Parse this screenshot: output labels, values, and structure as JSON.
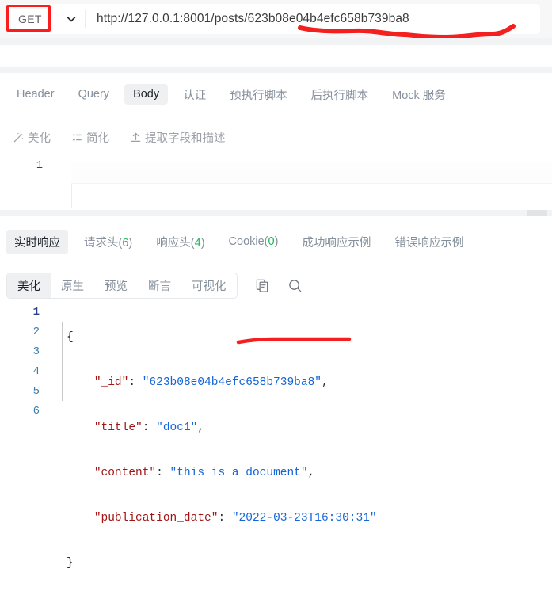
{
  "request": {
    "method": "GET",
    "url": "http://127.0.0.1:8001/posts/623b08e04b4efc658b739ba8",
    "method_dropdown_icon": "chevron-down-icon",
    "tabs": [
      {
        "label": "Header",
        "active": false
      },
      {
        "label": "Query",
        "active": false
      },
      {
        "label": "Body",
        "active": true
      },
      {
        "label": "认证",
        "active": false
      },
      {
        "label": "预执行脚本",
        "active": false
      },
      {
        "label": "后执行脚本",
        "active": false
      },
      {
        "label": "Mock 服务",
        "active": false
      }
    ],
    "tools": [
      {
        "label": "美化",
        "icon": "magic-wand-icon"
      },
      {
        "label": "简化",
        "icon": "compress-lines-icon"
      },
      {
        "label": "提取字段和描述",
        "icon": "upload-arrow-icon"
      }
    ],
    "editor": {
      "line_numbers": [
        "1"
      ],
      "content": ""
    }
  },
  "response": {
    "tabs": [
      {
        "label": "实时响应",
        "count": "",
        "active": true
      },
      {
        "label": "请求头",
        "count": "6",
        "active": false
      },
      {
        "label": "响应头",
        "count": "4",
        "active": false
      },
      {
        "label": "Cookie",
        "count": "0",
        "active": false
      },
      {
        "label": "成功响应示例",
        "count": "",
        "active": false
      },
      {
        "label": "错误响应示例",
        "count": "",
        "active": false
      }
    ],
    "view_modes": [
      {
        "label": "美化",
        "active": true
      },
      {
        "label": "原生",
        "active": false
      },
      {
        "label": "预览",
        "active": false
      },
      {
        "label": "断言",
        "active": false
      },
      {
        "label": "可视化",
        "active": false
      }
    ],
    "actions": [
      {
        "icon": "copy-icon",
        "label": "复制"
      },
      {
        "icon": "search-icon",
        "label": "搜索"
      }
    ],
    "body": {
      "line_numbers": [
        "1",
        "2",
        "3",
        "4",
        "5",
        "6"
      ],
      "lines": [
        {
          "indent": 0,
          "punct_open": "{",
          "key": "",
          "value": "",
          "punct_end": ""
        },
        {
          "indent": 1,
          "punct_open": "",
          "key": "\"_id\"",
          "value": "\"623b08e04b4efc658b739ba8\"",
          "punct_end": ","
        },
        {
          "indent": 1,
          "punct_open": "",
          "key": "\"title\"",
          "value": "\"doc1\"",
          "punct_end": ","
        },
        {
          "indent": 1,
          "punct_open": "",
          "key": "\"content\"",
          "value": "\"this is a document\"",
          "punct_end": ","
        },
        {
          "indent": 1,
          "punct_open": "",
          "key": "\"publication_date\"",
          "value": "\"2022-03-23T16:30:31\"",
          "punct_end": ""
        },
        {
          "indent": 0,
          "punct_open": "}",
          "key": "",
          "value": "",
          "punct_end": ""
        }
      ]
    }
  },
  "annotations": {
    "method_box_color": "#fb1c1c",
    "underline_color": "#f42020",
    "json_underline_color": "#f42020"
  },
  "colors": {
    "json_key": "#a31515",
    "json_value": "#1565d8",
    "accent_green": "#19b955",
    "tab_active_bg": "#eff0f2",
    "chrome_bg": "#f7f7f8"
  }
}
